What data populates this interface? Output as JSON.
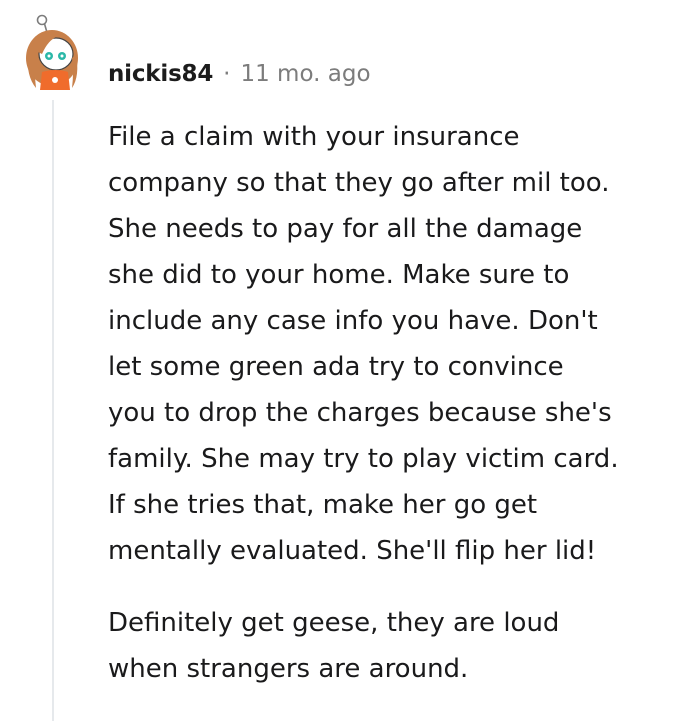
{
  "comment": {
    "username": "nickis84",
    "separator": "·",
    "timestamp": "11 mo. ago",
    "avatar_icon": "snoo-avatar-icon",
    "paragraphs": [
      "File a claim with your insurance\ncompany so that they go after mil too.\nShe needs to pay for all the damage\nshe did to your home. Make sure to\ninclude any case info you have. Don't\nlet some green ada try to convince\nyou to drop the charges because she's\nfamily. She may try to play victim card.\nIf she tries that, make her go get\nmentally evaluated. She'll flip her lid!",
      "Definitely get geese, they are loud\nwhen strangers are around."
    ]
  },
  "colors": {
    "text": "#1a1a1b",
    "meta": "#7c7c7c",
    "thread_line": "#e6e9ec",
    "avatar_hair": "#c8804a",
    "avatar_shirt": "#f06c2c",
    "avatar_eyes": "#2cb8a8"
  }
}
